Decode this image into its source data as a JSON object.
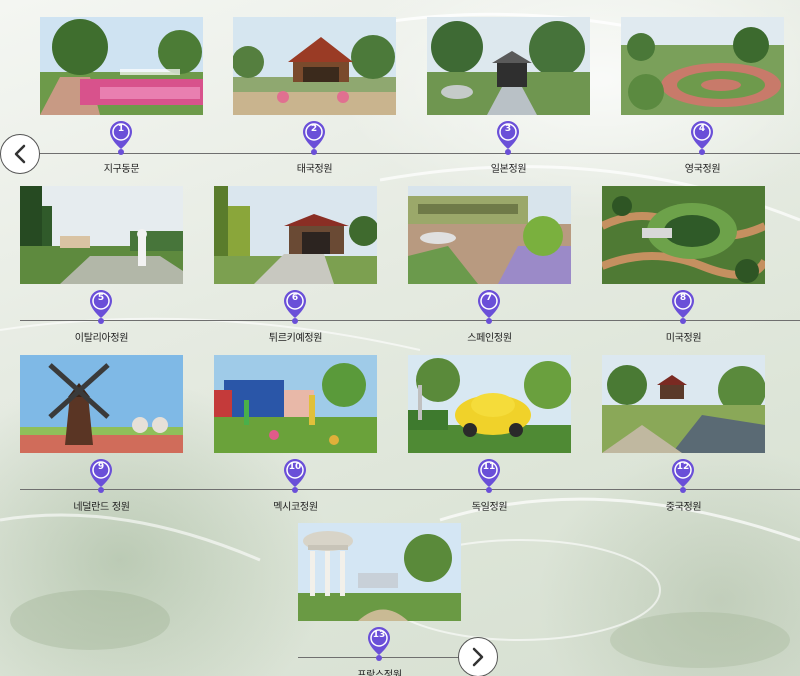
{
  "navigation": {
    "prev_icon": "chevron-left-icon",
    "next_icon": "chevron-right-icon"
  },
  "gardens": [
    {
      "number": "1",
      "name": "지구동문"
    },
    {
      "number": "2",
      "name": "태국정원"
    },
    {
      "number": "3",
      "name": "일본정원"
    },
    {
      "number": "4",
      "name": "영국정원"
    },
    {
      "number": "5",
      "name": "이탈리아정원"
    },
    {
      "number": "6",
      "name": "튀르키예정원"
    },
    {
      "number": "7",
      "name": "스페인정원"
    },
    {
      "number": "8",
      "name": "미국정원"
    },
    {
      "number": "9",
      "name": "네덜란드 정원"
    },
    {
      "number": "10",
      "name": "멕시코정원"
    },
    {
      "number": "11",
      "name": "독일정원"
    },
    {
      "number": "12",
      "name": "중국정원"
    },
    {
      "number": "13",
      "name": "프랑스정원"
    }
  ],
  "colors": {
    "pin": "#6a4fd8",
    "line": "#6f6f6f"
  }
}
